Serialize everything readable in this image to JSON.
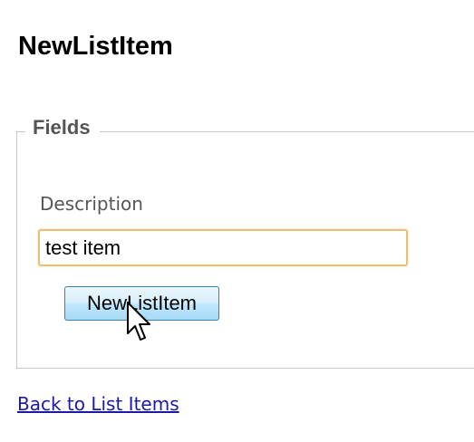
{
  "page": {
    "title": "NewListItem"
  },
  "fields": {
    "legend": "Fields",
    "description": {
      "label": "Description",
      "value": "test item"
    }
  },
  "actions": {
    "submit_label": "NewListItem"
  },
  "navigation": {
    "back_link": "Back to List Items"
  },
  "icons": {
    "cursor": "mouse-pointer-icon"
  },
  "colors": {
    "input_focus_border": "#e8c07a",
    "button_border": "#3c7fb1",
    "link": "#1a1aa6",
    "label": "#555555"
  }
}
